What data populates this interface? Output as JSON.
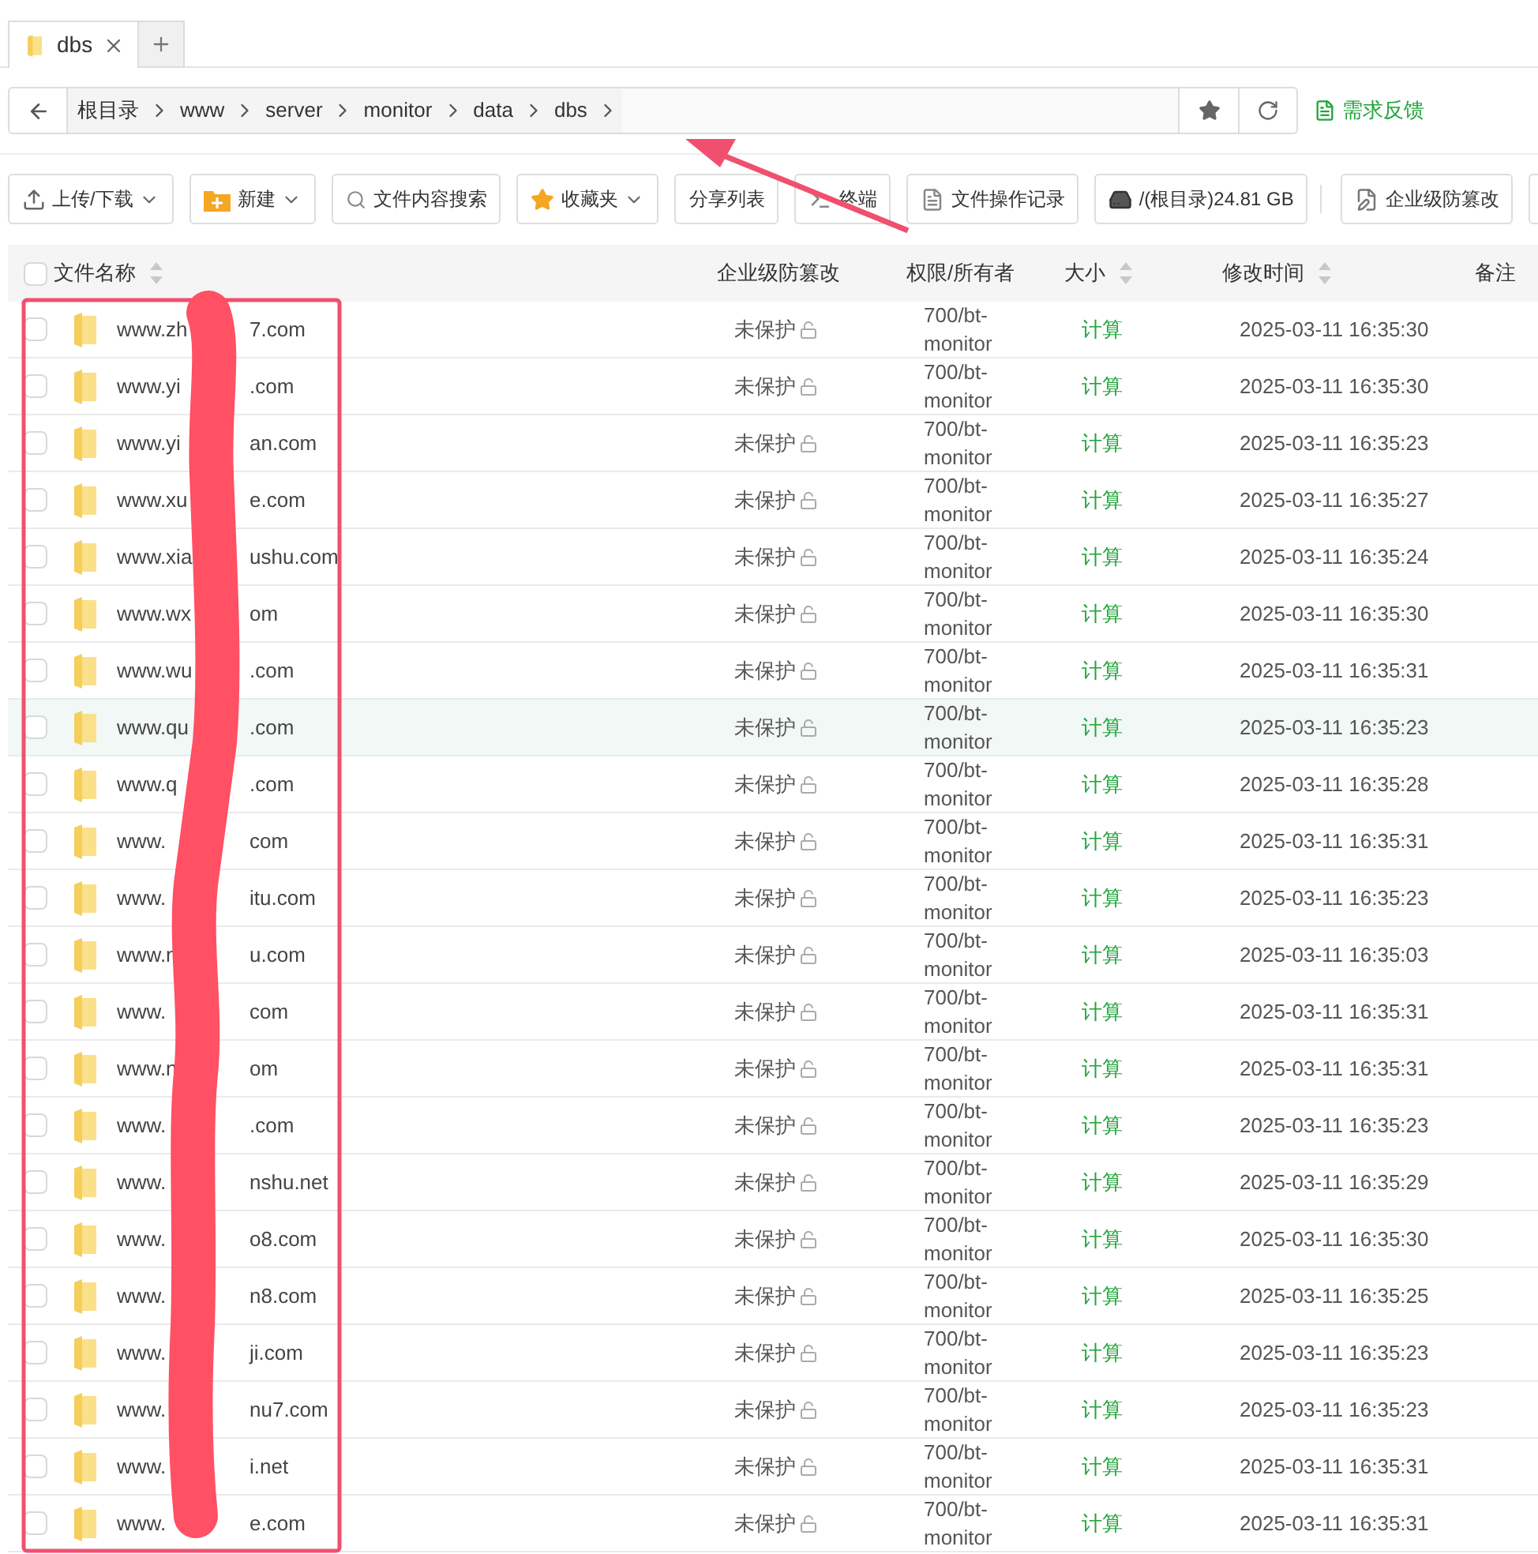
{
  "tabs": [
    {
      "label": "dbs",
      "selected": true
    }
  ],
  "breadcrumb": [
    "根目录",
    "www",
    "server",
    "monitor",
    "data",
    "dbs"
  ],
  "feedback": "需求反馈",
  "toolbar": [
    {
      "kind": "upload",
      "label": "上传/下载",
      "dropdown": true
    },
    {
      "kind": "new",
      "label": "新建",
      "dropdown": true
    },
    {
      "kind": "search",
      "label": "文件内容搜索",
      "dropdown": false
    },
    {
      "kind": "favorites",
      "label": "收藏夹",
      "dropdown": true
    },
    {
      "kind": "plain",
      "label": "分享列表",
      "dropdown": false
    },
    {
      "kind": "terminal",
      "label": "终端",
      "dropdown": false
    },
    {
      "kind": "log",
      "label": "文件操作记录",
      "dropdown": false
    },
    {
      "kind": "disk",
      "label": "/(根目录)24.81 GB",
      "dropdown": false
    },
    {
      "kind": "shield",
      "label": "企业级防篡改",
      "dropdown": false
    }
  ],
  "table": {
    "header_checked": false,
    "columns": [
      {
        "label": "文件名称",
        "sortable": true
      },
      {
        "label": "企业级防篡改",
        "sortable": false
      },
      {
        "label": "权限/所有者",
        "sortable": false
      },
      {
        "label": "大小",
        "sortable": true
      },
      {
        "label": "修改时间",
        "sortable": true
      },
      {
        "label": "备注",
        "sortable": false
      }
    ],
    "rows": [
      {
        "name_head": "www.zh",
        "name_tail": "7.com",
        "protection": "未保护",
        "owner": "700/bt-monitor",
        "size": "计算",
        "modified": "2025-03-11 16:35:30",
        "checked": false,
        "highlighted": false
      },
      {
        "name_head": "www.yi",
        "name_tail": ".com",
        "protection": "未保护",
        "owner": "700/bt-monitor",
        "size": "计算",
        "modified": "2025-03-11 16:35:30",
        "checked": false,
        "highlighted": false
      },
      {
        "name_head": "www.yi",
        "name_tail": "an.com",
        "protection": "未保护",
        "owner": "700/bt-monitor",
        "size": "计算",
        "modified": "2025-03-11 16:35:23",
        "checked": false,
        "highlighted": false
      },
      {
        "name_head": "www.xu",
        "name_tail": "e.com",
        "protection": "未保护",
        "owner": "700/bt-monitor",
        "size": "计算",
        "modified": "2025-03-11 16:35:27",
        "checked": false,
        "highlighted": false
      },
      {
        "name_head": "www.xia",
        "name_tail": "ushu.com",
        "protection": "未保护",
        "owner": "700/bt-monitor",
        "size": "计算",
        "modified": "2025-03-11 16:35:24",
        "checked": false,
        "highlighted": false
      },
      {
        "name_head": "www.wx",
        "name_tail": "om",
        "protection": "未保护",
        "owner": "700/bt-monitor",
        "size": "计算",
        "modified": "2025-03-11 16:35:30",
        "checked": false,
        "highlighted": false
      },
      {
        "name_head": "www.wu",
        "name_tail": ".com",
        "protection": "未保护",
        "owner": "700/bt-monitor",
        "size": "计算",
        "modified": "2025-03-11 16:35:31",
        "checked": false,
        "highlighted": false
      },
      {
        "name_head": "www.qu",
        "name_tail": ".com",
        "protection": "未保护",
        "owner": "700/bt-monitor",
        "size": "计算",
        "modified": "2025-03-11 16:35:23",
        "checked": false,
        "highlighted": true
      },
      {
        "name_head": "www.q",
        "name_tail": ".com",
        "protection": "未保护",
        "owner": "700/bt-monitor",
        "size": "计算",
        "modified": "2025-03-11 16:35:28",
        "checked": false,
        "highlighted": false
      },
      {
        "name_head": "www.",
        "name_tail": "com",
        "protection": "未保护",
        "owner": "700/bt-monitor",
        "size": "计算",
        "modified": "2025-03-11 16:35:31",
        "checked": false,
        "highlighted": false
      },
      {
        "name_head": "www.",
        "name_tail": "itu.com",
        "protection": "未保护",
        "owner": "700/bt-monitor",
        "size": "计算",
        "modified": "2025-03-11 16:35:23",
        "checked": false,
        "highlighted": false
      },
      {
        "name_head": "www.n",
        "name_tail": "u.com",
        "protection": "未保护",
        "owner": "700/bt-monitor",
        "size": "计算",
        "modified": "2025-03-11 16:35:03",
        "checked": false,
        "highlighted": false
      },
      {
        "name_head": "www.",
        "name_tail": "com",
        "protection": "未保护",
        "owner": "700/bt-monitor",
        "size": "计算",
        "modified": "2025-03-11 16:35:31",
        "checked": false,
        "highlighted": false
      },
      {
        "name_head": "www.n",
        "name_tail": "om",
        "protection": "未保护",
        "owner": "700/bt-monitor",
        "size": "计算",
        "modified": "2025-03-11 16:35:31",
        "checked": false,
        "highlighted": false
      },
      {
        "name_head": "www.",
        "name_tail": ".com",
        "protection": "未保护",
        "owner": "700/bt-monitor",
        "size": "计算",
        "modified": "2025-03-11 16:35:23",
        "checked": false,
        "highlighted": false
      },
      {
        "name_head": "www.",
        "name_tail": "nshu.net",
        "protection": "未保护",
        "owner": "700/bt-monitor",
        "size": "计算",
        "modified": "2025-03-11 16:35:29",
        "checked": false,
        "highlighted": false
      },
      {
        "name_head": "www.",
        "name_tail": "o8.com",
        "protection": "未保护",
        "owner": "700/bt-monitor",
        "size": "计算",
        "modified": "2025-03-11 16:35:30",
        "checked": false,
        "highlighted": false
      },
      {
        "name_head": "www.",
        "name_tail": "n8.com",
        "protection": "未保护",
        "owner": "700/bt-monitor",
        "size": "计算",
        "modified": "2025-03-11 16:35:25",
        "checked": false,
        "highlighted": false
      },
      {
        "name_head": "www.",
        "name_tail": "ji.com",
        "protection": "未保护",
        "owner": "700/bt-monitor",
        "size": "计算",
        "modified": "2025-03-11 16:35:23",
        "checked": false,
        "highlighted": false
      },
      {
        "name_head": "www.",
        "name_tail": "nu7.com",
        "protection": "未保护",
        "owner": "700/bt-monitor",
        "size": "计算",
        "modified": "2025-03-11 16:35:23",
        "checked": false,
        "highlighted": false
      },
      {
        "name_head": "www.",
        "name_tail": "i.net",
        "protection": "未保护",
        "owner": "700/bt-monitor",
        "size": "计算",
        "modified": "2025-03-11 16:35:31",
        "checked": false,
        "highlighted": false
      },
      {
        "name_head": "www.",
        "name_tail": "e.com",
        "protection": "未保护",
        "owner": "700/bt-monitor",
        "size": "计算",
        "modified": "2025-03-11 16:35:31",
        "checked": false,
        "highlighted": false
      }
    ]
  }
}
